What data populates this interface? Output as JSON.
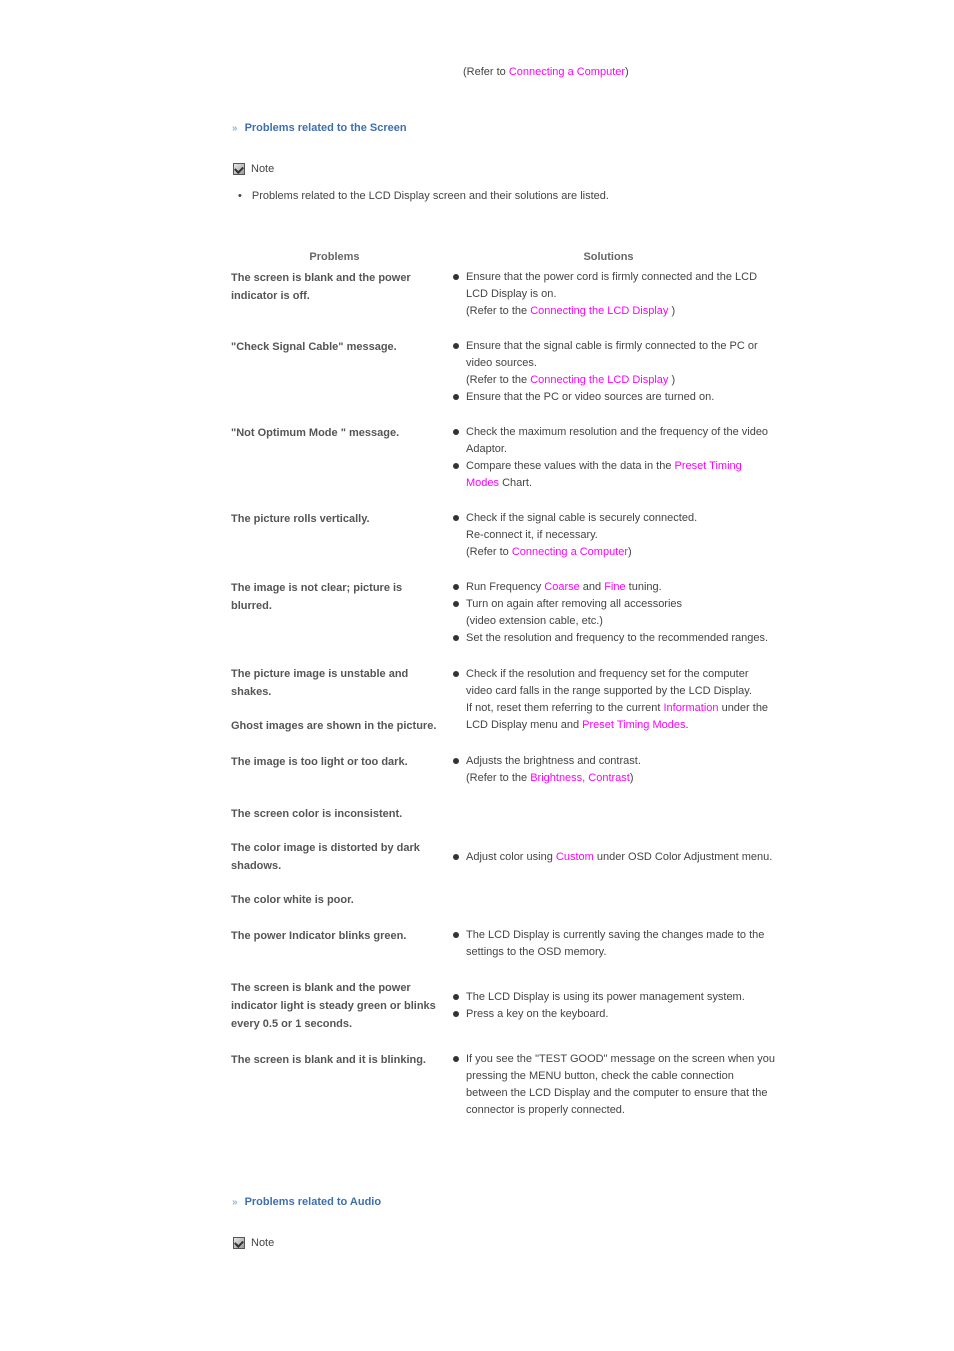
{
  "top_ref": {
    "prefix": "(Refer to ",
    "link": "Connecting a Computer",
    "suffix": ")"
  },
  "section_screen": {
    "title": "Problems related to the Screen",
    "arrow_icon": "double-chevron-right-icon"
  },
  "note1": {
    "label": "Note",
    "icon": "note-checkbox-icon"
  },
  "intro": {
    "bullet": "•",
    "text": "Problems related to the LCD Display screen and their solutions are listed."
  },
  "table": {
    "headers": {
      "problems": "Problems",
      "solutions": "Solutions"
    },
    "rows": [
      {
        "problems": [
          "The screen is blank and the power indicator is off."
        ],
        "solutions": [
          {
            "text": "Ensure that the power cord is firmly connected and the LCD LCD Display is on.",
            "ref_prefix": "(Refer to the ",
            "ref_link": "Connecting the LCD Display",
            "ref_suffix": " )"
          }
        ]
      },
      {
        "problems": [
          "\"Check Signal Cable\" message."
        ],
        "solutions": [
          {
            "text": "Ensure that the signal cable is firmly connected to the PC or video sources.",
            "ref_prefix": "(Refer to the ",
            "ref_link": "Connecting the LCD Display",
            "ref_suffix": " )"
          },
          {
            "text": "Ensure that the PC or video sources are turned on."
          }
        ]
      },
      {
        "problems": [
          "\"Not Optimum Mode \" message."
        ],
        "solutions": [
          {
            "text": "Check the maximum resolution and the frequency of the video Adaptor."
          },
          {
            "pre": "Compare these values with the data in the ",
            "link": "Preset Timing Modes",
            "post": " Chart."
          }
        ]
      },
      {
        "problems": [
          "The picture rolls vertically."
        ],
        "solutions": [
          {
            "text": "Check if the signal cable is securely connected.",
            "line2": "Re-connect it, if necessary.",
            "ref_prefix": "(Refer to ",
            "ref_link": "Connecting a Computer",
            "ref_suffix": ")"
          }
        ]
      },
      {
        "problems": [
          "The image is not clear; picture is blurred."
        ],
        "solutions": [
          {
            "pre": "Run Frequency ",
            "link": "Coarse",
            "mid": " and ",
            "link2": "Fine",
            "post": " tuning."
          },
          {
            "text": "Turn on again after removing all accessories",
            "line2": "(video extension cable, etc.)"
          },
          {
            "text": "Set the resolution and frequency to the recommended ranges."
          }
        ]
      },
      {
        "problems": [
          "The picture image is unstable and shakes.",
          "Ghost images are shown in the picture."
        ],
        "solutions": [
          {
            "text": "Check if the resolution and frequency set for the computer video card falls in the range supported by the LCD Display.",
            "pre2": "If not, reset them referring to the current ",
            "link": "Information",
            "mid": " under the LCD Display menu and ",
            "link2": "Preset Timing Modes",
            "post": "."
          }
        ]
      },
      {
        "problems": [
          "The image is too light or too dark."
        ],
        "solutions": [
          {
            "text": "Adjusts the brightness and contrast.",
            "ref_prefix": "(Refer to the ",
            "ref_link": "Brightness, Contrast",
            "ref_suffix": ")"
          }
        ]
      },
      {
        "problems": [
          "The screen color is inconsistent.",
          "The color image is distorted by dark shadows.",
          "The color white is poor."
        ],
        "solutions": [
          {
            "pre": "Adjust color using ",
            "link": "Custom",
            "post": " under OSD Color Adjustment menu."
          }
        ]
      },
      {
        "problems": [
          "The power Indicator blinks green."
        ],
        "solutions": [
          {
            "text": "The LCD Display is currently saving the changes made to the settings to the OSD memory."
          }
        ]
      },
      {
        "problems": [
          "The screen is blank and the power indicator light is steady green or blinks every 0.5 or 1 seconds."
        ],
        "solutions": [
          {
            "text": "The LCD Display is using its power management system."
          },
          {
            "text": "Press a key on the keyboard."
          }
        ]
      },
      {
        "problems": [
          "The screen is blank and it is blinking."
        ],
        "solutions": [
          {
            "text": "If you see the \"TEST GOOD\" message on the screen when you pressing the MENU button, check the cable connection between the LCD Display and the computer to ensure that the connector is properly connected."
          }
        ]
      }
    ]
  },
  "section_audio": {
    "title": "Problems related to Audio",
    "arrow_icon": "double-chevron-right-icon"
  },
  "note2": {
    "label": "Note",
    "icon": "note-checkbox-icon"
  },
  "colors": {
    "link": "#ff00ff",
    "section_heading": "#3f6fad",
    "text": "#444444"
  }
}
